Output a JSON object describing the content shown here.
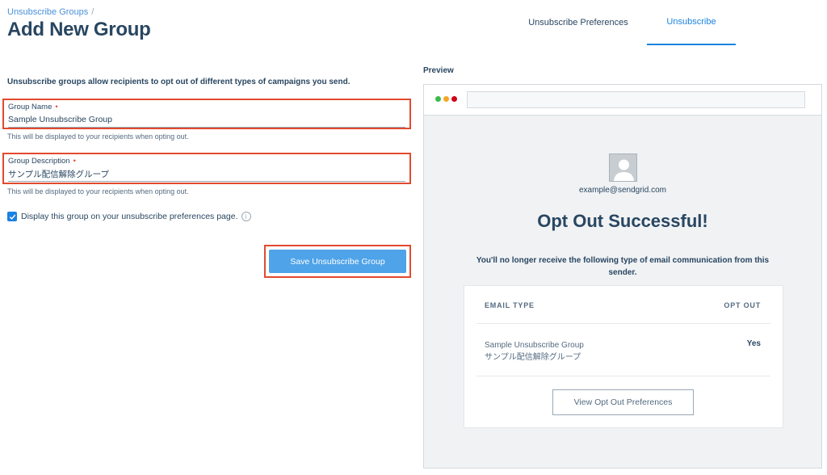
{
  "breadcrumb": {
    "parent": "Unsubscribe Groups",
    "separator": "/"
  },
  "page_title": "Add New Group",
  "tabs": [
    {
      "label": "Unsubscribe Preferences",
      "active": false
    },
    {
      "label": "Unsubscribe",
      "active": true
    }
  ],
  "form": {
    "intro": "Unsubscribe groups allow recipients to opt out of different types of campaigns you send.",
    "group_name": {
      "label": "Group Name",
      "required_mark": "•",
      "value": "Sample Unsubscribe Group",
      "hint": "This will be displayed to your recipients when opting out."
    },
    "group_description": {
      "label": "Group Description",
      "required_mark": "•",
      "value": "サンプル配信解除グループ",
      "hint": "This will be displayed to your recipients when opting out."
    },
    "display_checkbox": {
      "checked": true,
      "label": "Display this group on your unsubscribe preferences page.",
      "info_icon": "i"
    },
    "save_label": "Save Unsubscribe Group"
  },
  "preview": {
    "label": "Preview",
    "window_dots": [
      "#3dba4e",
      "#f5a623",
      "#d0021b"
    ],
    "email": "example@sendgrid.com",
    "title": "Opt Out Successful!",
    "message": "You'll no longer receive the following type of email communication from this sender.",
    "table": {
      "col_type": "EMAIL TYPE",
      "col_opt": "OPT OUT",
      "row_name": "Sample Unsubscribe Group",
      "row_description": "サンプル配信解除グループ",
      "row_value": "Yes"
    },
    "view_button": "View Opt Out Preferences"
  },
  "colors": {
    "accent": "#1a82e2",
    "highlight_border": "#e24a2e",
    "primary_button": "#4fa3e8"
  }
}
